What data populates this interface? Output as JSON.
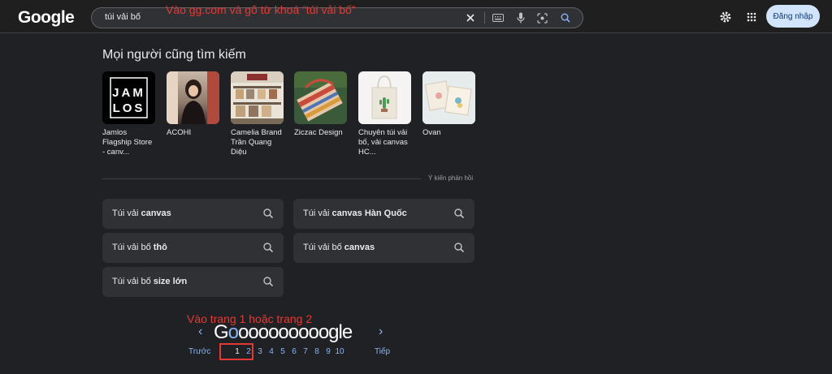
{
  "header": {
    "logo": "Google",
    "search_query": "túi vải bố",
    "annotation": "Vào gg.com và gõ từ khoá “túi vải bố”",
    "sign_in": "Đăng nhập"
  },
  "people_also_search": {
    "title": "Mọi người cũng tìm kiếm",
    "items": [
      {
        "label": "Jamlos Flagship Store - canv..."
      },
      {
        "label": "ACOHI"
      },
      {
        "label": "Camelia Brand Trần Quang Diệu"
      },
      {
        "label": "Ziczac Design"
      },
      {
        "label": "Chuyên túi vải bố, vải canvas HC..."
      },
      {
        "label": "Ovan"
      }
    ],
    "logo_letters": [
      "J",
      "A",
      "M",
      "L",
      "O",
      "S"
    ],
    "feedback": "Ý kiến phản hồi"
  },
  "related": [
    {
      "prefix": "Túi vải ",
      "bold": "canvas"
    },
    {
      "prefix": "Túi vải ",
      "bold": "canvas Hàn Quốc"
    },
    {
      "prefix": "Túi vải bố ",
      "bold": "thô"
    },
    {
      "prefix": "Túi vải bố ",
      "bold": "canvas"
    },
    {
      "prefix": "Túi vải bố ",
      "bold": "size lớn"
    }
  ],
  "pagination": {
    "annotation": "Vào trang 1 hoặc trang 2",
    "logo_g": "G",
    "logo_os": "ooooooooo",
    "logo_tail": "gle",
    "prev": "Trước",
    "next": "Tiếp",
    "pages": [
      "1",
      "2",
      "3",
      "4",
      "5",
      "6",
      "7",
      "8",
      "9",
      "10"
    ]
  }
}
